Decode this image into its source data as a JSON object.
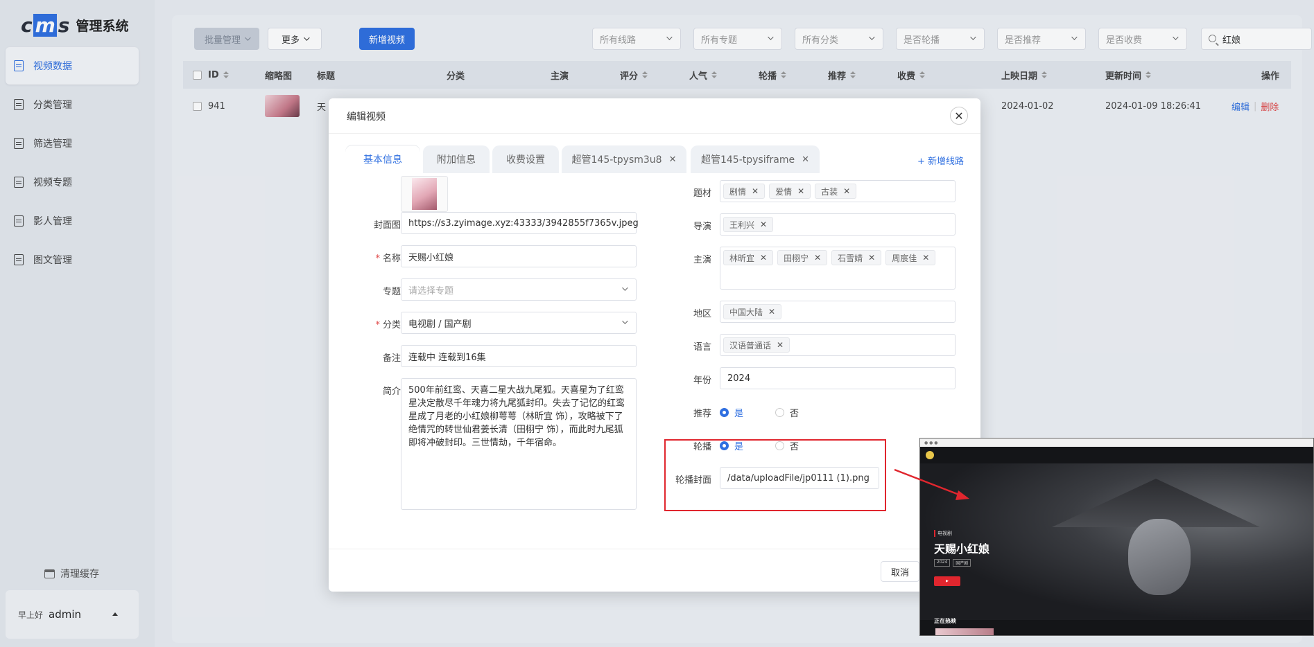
{
  "app": {
    "logo_text": "cms",
    "title": "管理系统"
  },
  "sidebar": {
    "items": [
      {
        "label": "视频数据",
        "active": true
      },
      {
        "label": "分类管理"
      },
      {
        "label": "筛选管理"
      },
      {
        "label": "视频专题"
      },
      {
        "label": "影人管理"
      },
      {
        "label": "图文管理"
      }
    ],
    "clear_cache": "清理缓存",
    "greeting": "早上好",
    "username": "admin"
  },
  "toolbar": {
    "batch": "批量管理",
    "more": "更多",
    "add_video": "新增视频",
    "filters": [
      "所有线路",
      "所有专题",
      "所有分类",
      "是否轮播",
      "是否推荐",
      "是否收费"
    ],
    "search_value": "红娘"
  },
  "table": {
    "headers": [
      "ID",
      "缩略图",
      "标题",
      "分类",
      "主演",
      "评分",
      "人气",
      "轮播",
      "推荐",
      "收费",
      "上映日期",
      "更新时间",
      "操作"
    ],
    "row": {
      "id": "941",
      "title": "天",
      "release_date": "2024-01-02",
      "updated": "2024-01-09 18:26:41",
      "edit": "编辑",
      "delete": "删除"
    }
  },
  "modal": {
    "title": "编辑视频",
    "tabs": [
      "基本信息",
      "附加信息",
      "收费设置",
      "超管145-tpysm3u8",
      "超管145-tpysiframe"
    ],
    "add_route": "+ 新增线路",
    "fields": {
      "cover_label": "封面图",
      "cover_value": "https://s3.zyimage.xyz:43333/3942855f7365v.jpeg",
      "name_label": "名称",
      "name_value": "天赐小红娘",
      "topic_label": "专题",
      "topic_placeholder": "请选择专题",
      "category_label": "分类",
      "category_value": "电视剧 / 国产剧",
      "note_label": "备注",
      "note_value": "连载中 连载到16集",
      "intro_label": "简介",
      "intro_value": "500年前红鸾、天喜二星大战九尾狐。天喜星为了红鸾星决定散尽千年魂力将九尾狐封印。失去了记忆的红鸾星成了月老的小红娘柳萼萼（林昕宜 饰），攻略被下了绝情咒的转世仙君姜长清（田栩宁 饰），而此时九尾狐即将冲破封印。三世情劫，千年宿命。",
      "genre_label": "题材",
      "genre_tags": [
        "剧情",
        "爱情",
        "古装"
      ],
      "director_label": "导演",
      "director_tags": [
        "王利兴"
      ],
      "cast_label": "主演",
      "cast_tags": [
        "林昕宜",
        "田栩宁",
        "石雪婧",
        "周宸佳"
      ],
      "region_label": "地区",
      "region_tags": [
        "中国大陆"
      ],
      "language_label": "语言",
      "language_tags": [
        "汉语普通话"
      ],
      "year_label": "年份",
      "year_value": "2024",
      "recommend_label": "推荐",
      "carousel_label": "轮播",
      "yes": "是",
      "no": "否",
      "carousel_cover_label": "轮播封面",
      "carousel_cover_value": "/data/uploadFile/jp0111 (1).png"
    },
    "cancel": "取消"
  },
  "preview": {
    "category": "电视剧",
    "title": "天赐小红娘",
    "meta": [
      "2024",
      "国产剧"
    ],
    "section": "正在热映"
  },
  "colors": {
    "primary": "#2f6fe0",
    "danger": "#e0262e"
  }
}
